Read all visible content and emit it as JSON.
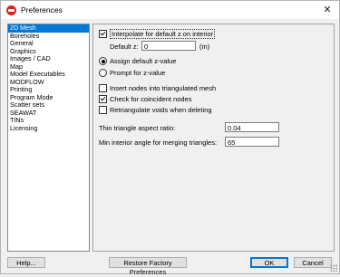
{
  "window": {
    "title": "Preferences"
  },
  "sidebar": {
    "items": [
      {
        "label": "2D Mesh",
        "selected": true
      },
      {
        "label": "Boreholes"
      },
      {
        "label": "General"
      },
      {
        "label": "Graphics"
      },
      {
        "label": "Images / CAD"
      },
      {
        "label": "Map"
      },
      {
        "label": "Model Executables"
      },
      {
        "label": "MODFLOW"
      },
      {
        "label": "Printing"
      },
      {
        "label": "Program Mode"
      },
      {
        "label": "Scatter sets"
      },
      {
        "label": "SEAWAT"
      },
      {
        "label": "TINs"
      },
      {
        "label": "Licensing"
      }
    ]
  },
  "mesh": {
    "interpolate_label": "Interpolate for default z on interior",
    "interpolate_checked": true,
    "default_z_label": "Default z:",
    "default_z_value": "0",
    "default_z_unit": "(m)",
    "assign_default_label": "Assign default z-value",
    "prompt_label": "Prompt for z-value",
    "z_mode_selected": "Assign default z-value",
    "insert_nodes_label": "Insert nodes into triangulated mesh",
    "insert_nodes_checked": false,
    "check_coincident_label": "Check for coincident nodes",
    "check_coincident_checked": true,
    "retriangulate_label": "Retriangulate voids when deleting",
    "retriangulate_checked": false,
    "thin_triangle_label": "Thin triangle aspect ratio:",
    "thin_triangle_value": "0.04",
    "min_angle_label": "Min interior angle for merging triangles:",
    "min_angle_value": "65"
  },
  "buttons": {
    "help": "Help...",
    "restore": "Restore Factory Preferences",
    "ok": "OK",
    "cancel": "Cancel"
  }
}
